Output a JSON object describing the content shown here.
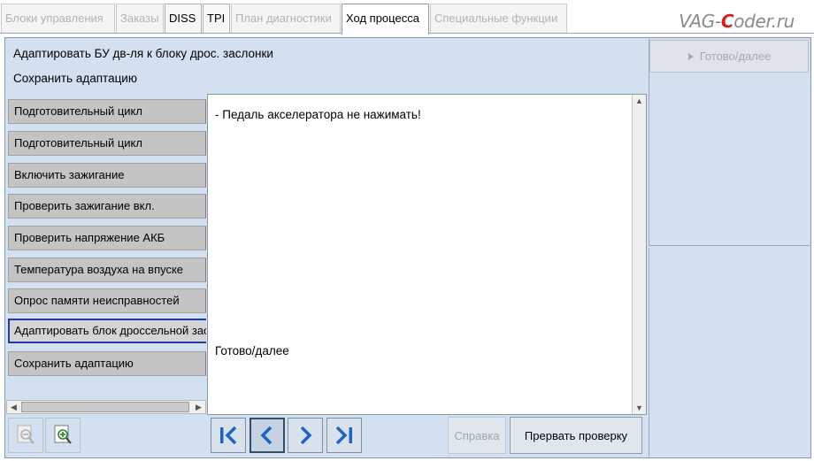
{
  "tabs": [
    {
      "label": "Блоки управления",
      "state": "disabled"
    },
    {
      "label": "Заказы",
      "state": "disabled"
    },
    {
      "label": "DISS",
      "state": "enabled"
    },
    {
      "label": "TPI",
      "state": "enabled"
    },
    {
      "label": "План диагностики",
      "state": "disabled"
    },
    {
      "label": "Ход процесса",
      "state": "active"
    },
    {
      "label": "Специальные функции",
      "state": "disabled"
    }
  ],
  "logo": {
    "part1": "VAG-",
    "accent": "C",
    "part2": "oder.ru"
  },
  "header": {
    "line1": "Адаптировать БУ дв-ля к блоку дрос. заслонки",
    "line2": "Сохранить адаптацию"
  },
  "right_panel": {
    "ready_label": "Готово/далее"
  },
  "steps": [
    {
      "label": "Подготовительный цикл"
    },
    {
      "label": "Подготовительный цикл"
    },
    {
      "label": "Включить зажигание"
    },
    {
      "label": "Проверить зажигание вкл."
    },
    {
      "label": "Проверить напряжение АКБ"
    },
    {
      "label": "Температура воздуха на впуске"
    },
    {
      "label": "Опрос памяти неисправностей"
    },
    {
      "label": "Адаптировать блок дроссельной заслонки"
    },
    {
      "label": "Сохранить адаптацию"
    }
  ],
  "current_step_index": 7,
  "content": {
    "message": "- Педаль акселератора не нажимать!",
    "footer_text": "Готово/далее"
  },
  "toolbar": {
    "help_label": "Справка",
    "abort_label": "Прервать проверку"
  },
  "colors": {
    "panel_bg": "#d3e0ef",
    "nav_arrow": "#1f63c4",
    "current_step_border": "#2638a8"
  },
  "icons": {
    "zoom_out": "zoom-out-icon",
    "zoom_in": "zoom-in-icon",
    "first": "skip-first-icon",
    "prev": "chevron-left-icon",
    "next": "chevron-right-icon",
    "last": "skip-last-icon"
  }
}
